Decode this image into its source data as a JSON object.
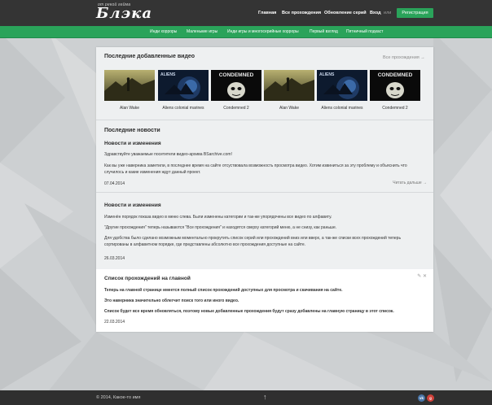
{
  "header": {
    "logo_tagline": "от рекой гейма",
    "logo_title": "Блэка",
    "nav": [
      "Главная",
      "Все прохождения",
      "Обновление серий",
      "Вход"
    ],
    "or_label": "или",
    "register_label": "Регистрация"
  },
  "categories": [
    "Инди хорроры",
    "Маленькие игры",
    "Инди игры и многосерийные хорроры",
    "Первый взгляд",
    "Пятничный подкаст"
  ],
  "latest_videos": {
    "title": "Последние добавленные видео",
    "all_link": "Все прохождения →",
    "items": [
      {
        "caption": "Alan Wake",
        "thumb": "alan-wake"
      },
      {
        "caption": "Aliens colonial marines",
        "thumb": "aliens"
      },
      {
        "caption": "Condemned 2",
        "thumb": "condemned"
      },
      {
        "caption": "Alan Wake",
        "thumb": "alan-wake"
      },
      {
        "caption": "Aliens colonial marines",
        "thumb": "aliens"
      },
      {
        "caption": "Condemned 2",
        "thumb": "condemned"
      }
    ],
    "thumb_texts": {
      "aliens": "ALIENS",
      "condemned": "CONDEMNED"
    }
  },
  "news": {
    "title": "Последние новости",
    "items": [
      {
        "title": "Новости и изменения",
        "paragraphs": [
          "Здравствуйте уважаемые посетители видео-архива BSarchive.com!",
          "Как вы уже наверника заметили, в последнее время на сайте отсуствовала возможность просмотра видео. Хотим извиниться за эту проблему и объяснить что случилось и какие изменения ждут данный проект."
        ],
        "date": "07.04.2014",
        "read_more": "Читать дальше →"
      },
      {
        "title": "Новости и изменения",
        "paragraphs": [
          "Изменён порядок показа видео в меню слева. Были изменены категории и так-же упорядочены все видео по алфавиту.",
          "\"Другие прохождения\" теперь называются \"Все прохождения\" и находятся сверху категорий меню, а не снизу, как раньше.",
          "Для удобства было сделано возможным моментально прокрутить список серий или прохождений вниз или вверх, а так-же списки всех прохождений теперь сортированы в алфавитном порядке, где представлены абсолютно все прохождения доступные на сайте."
        ],
        "date": "26.03.2014"
      },
      {
        "title": "Список прохождений на главной",
        "paragraphs": [
          "Теперь на главной странице имеется полный список прохождений доступных для просмотра и скачивания на сайте.",
          "Это наверника значительно облегчит поиск того или иного видео.",
          "Список будет все время обновляться, поэтому новые добавленные прохождения будут сразу добавлены на главную страницу в этот список."
        ],
        "date": "22.03.2014"
      }
    ]
  },
  "footer": {
    "copyright": "© 2014, Какое-то имя",
    "up_arrow": "↑",
    "social": [
      {
        "label": "vk",
        "color": "#4a76a8"
      },
      {
        "label": "g",
        "color": "#d0413a"
      }
    ]
  },
  "colors": {
    "accent": "#2aa35a",
    "header_bg": "#343434",
    "footer_bg": "#2f2f2f"
  }
}
